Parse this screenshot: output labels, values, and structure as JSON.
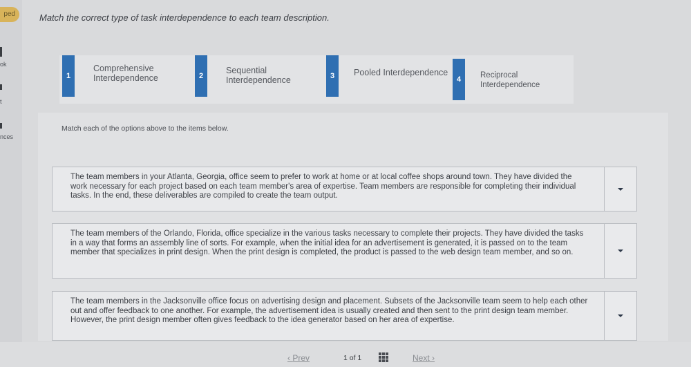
{
  "sidebar": {
    "badge": "ped",
    "items": [
      "ok",
      "t",
      "nces"
    ]
  },
  "question": {
    "prompt": "Match the correct type of task interdependence to each team description."
  },
  "options": [
    {
      "number": "1",
      "label": "Comprehensive Interdependence"
    },
    {
      "number": "2",
      "label": "Sequential Interdependence"
    },
    {
      "number": "3",
      "label": "Pooled Interdependence"
    },
    {
      "number": "4",
      "label": "Reciprocal Interdependence"
    }
  ],
  "match": {
    "instruction": "Match each of the options above to the items below.",
    "items": [
      {
        "text": "The team members in your Atlanta, Georgia, office seem to prefer to work at home or at local coffee shops around town. They have divided the work necessary for each project based on each team member's area of expertise. Team members are responsible for completing their individual tasks. In the end, these deliverables are compiled to create the team output."
      },
      {
        "text": "The team members of the Orlando, Florida, office specialize in the various tasks necessary to complete their projects. They have divided the tasks in a way that forms an assembly line of sorts. For example, when the initial idea for an advertisement is generated, it is passed on to the team member that specializes in print design. When the print design is completed, the product is passed to the web design team member, and so on."
      },
      {
        "text": "The team members in the Jacksonville office focus on advertising design and placement. Subsets of the Jacksonville team seem to help each other out and offer feedback to one another. For example, the advertisement idea is usually created and then sent to the print design team member. However, the print design member often gives feedback to the idea generator based on her area of expertise."
      }
    ]
  },
  "footer": {
    "prev": "Prev",
    "page_info": "1 of 1",
    "next": "Next"
  },
  "colors": {
    "accent": "#2f6fb2",
    "badge": "#d8b35a"
  }
}
